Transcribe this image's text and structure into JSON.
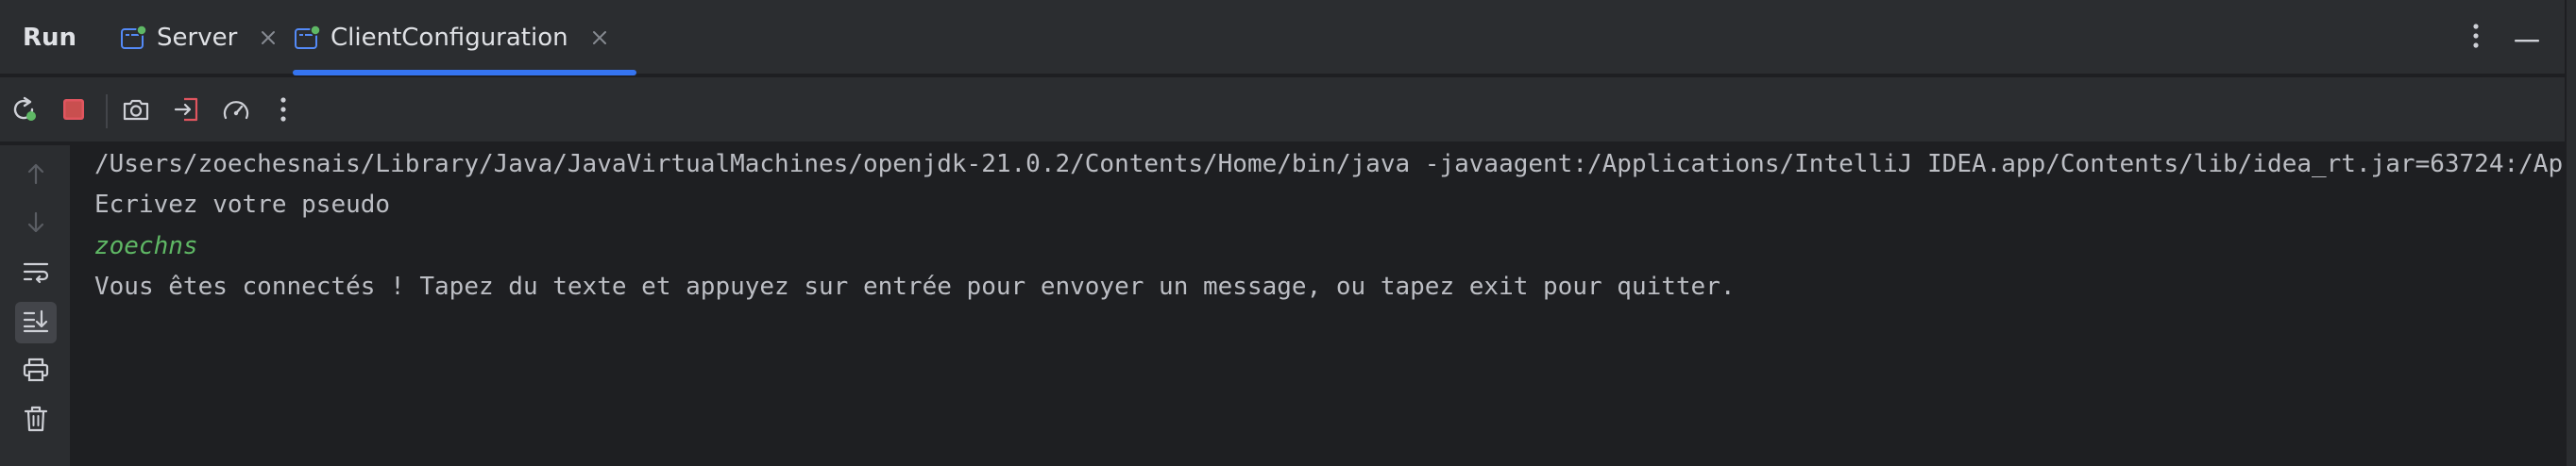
{
  "panel": {
    "title": "Run"
  },
  "tabs": [
    {
      "label": "Server",
      "active": false,
      "icon": "application-config-icon"
    },
    {
      "label": "ClientConfiguration",
      "active": true,
      "icon": "application-config-icon"
    }
  ],
  "header_actions": {
    "more_icon": "vertical-ellipsis-icon",
    "minimize_icon": "minimize-icon"
  },
  "toolbar": {
    "icons": [
      "rerun-icon",
      "stop-icon",
      "camera-icon",
      "exit-icon",
      "speedometer-icon",
      "vertical-ellipsis-icon"
    ]
  },
  "gutter": {
    "icons": [
      "arrow-up-icon",
      "arrow-down-icon",
      "soft-wrap-icon",
      "scroll-to-end-icon",
      "print-icon",
      "trash-icon"
    ]
  },
  "console": {
    "lines": [
      "/Users/zoechesnais/Library/Java/JavaVirtualMachines/openjdk-21.0.2/Contents/Home/bin/java -javaagent:/Applications/IntelliJ IDEA.app/Contents/lib/idea_rt.jar=63724:/App",
      "Ecrivez votre pseudo",
      "zoechns",
      "Vous êtes connectés ! Tapez du texte et appuyez sur entrée pour envoyer un message, ou tapez exit pour quitter."
    ]
  },
  "colors": {
    "background": "#1e1f22",
    "panel": "#2b2d30",
    "accent": "#3574f0",
    "text": "#bcbec4",
    "user_input": "#5fb865",
    "stop": "#e0555f",
    "run_badge": "#5fb865"
  }
}
